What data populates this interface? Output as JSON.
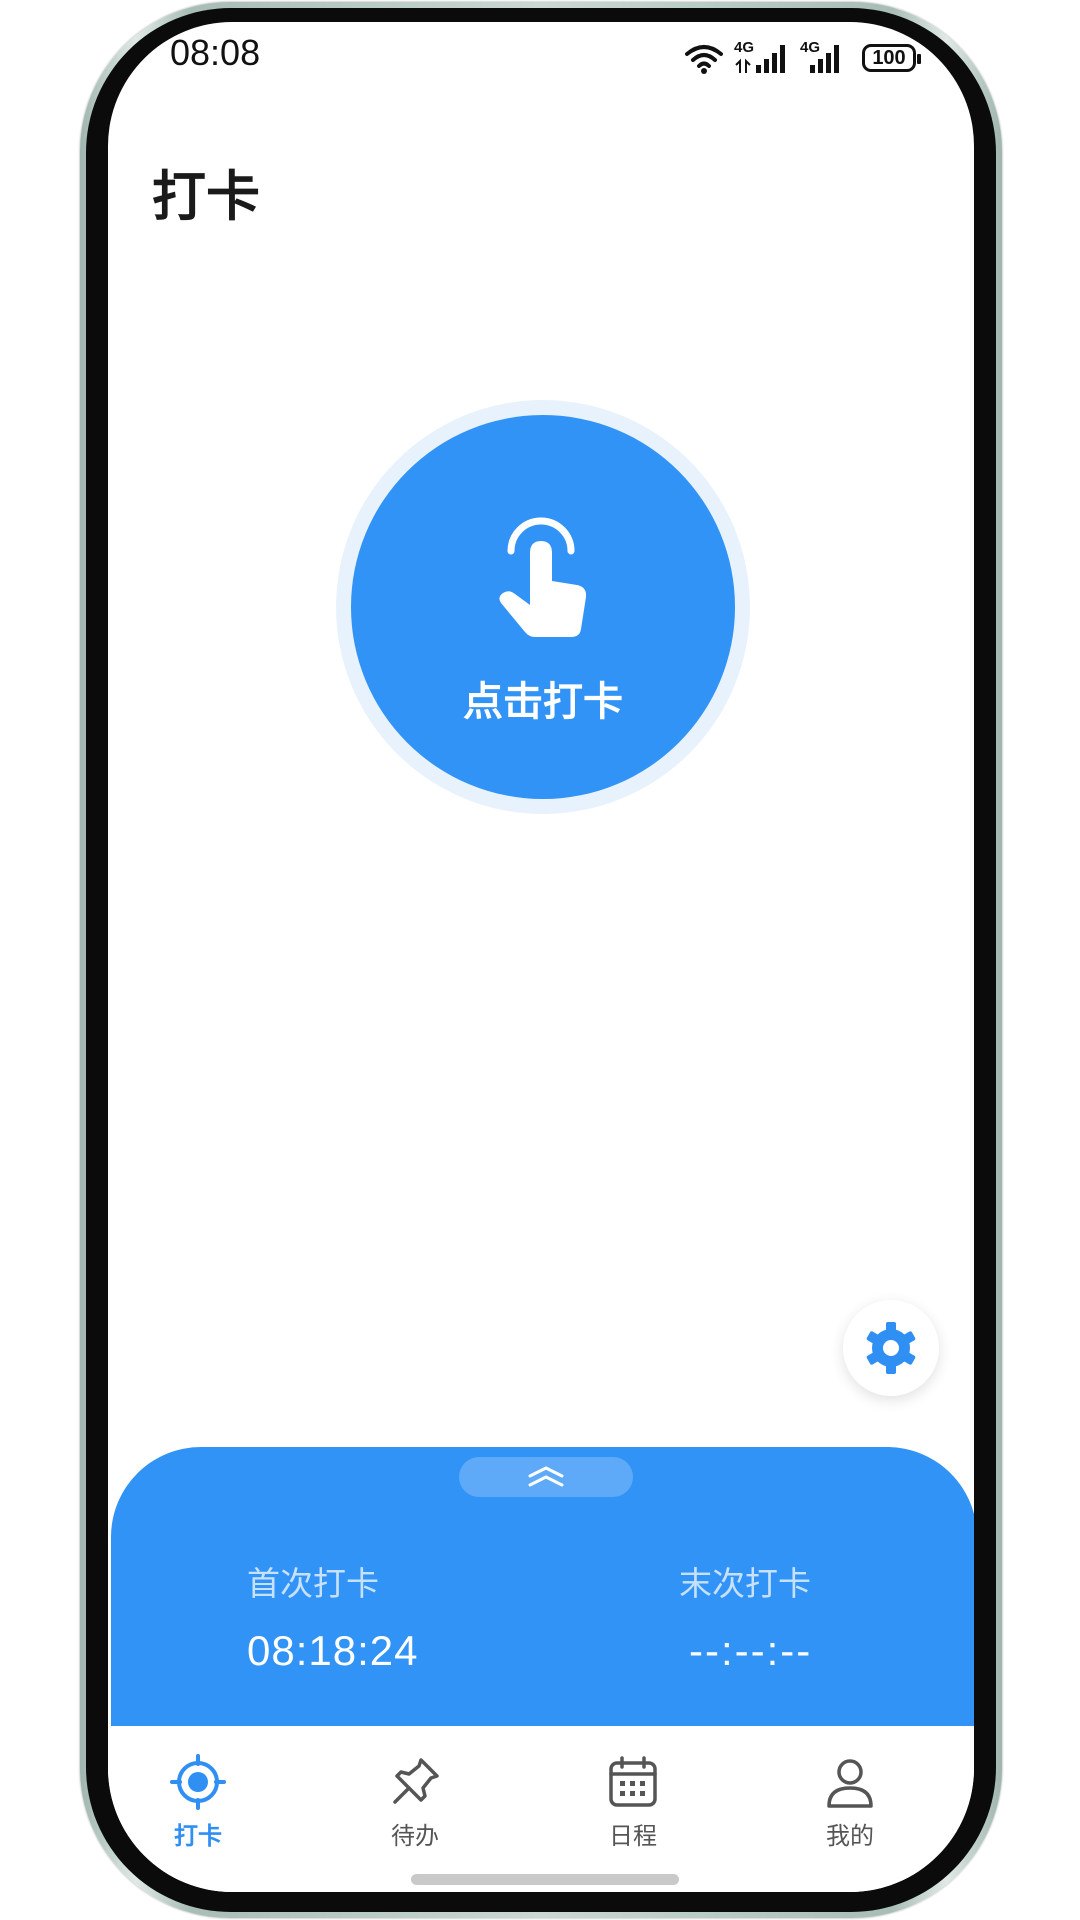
{
  "status_bar": {
    "time": "08:08",
    "battery": "100",
    "network_1": "4G",
    "network_2": "4G"
  },
  "page": {
    "title": "打卡"
  },
  "punch_button": {
    "label": "点击打卡",
    "icon": "tap-hand-icon"
  },
  "settings": {
    "icon": "gear-icon"
  },
  "summary": {
    "first_label": "首次打卡",
    "first_time": "08:18:24",
    "last_label": "末次打卡",
    "last_time": "--:--:--"
  },
  "tabs": [
    {
      "label": "打卡",
      "icon": "locate-icon",
      "active": true
    },
    {
      "label": "待办",
      "icon": "pin-icon",
      "active": false
    },
    {
      "label": "日程",
      "icon": "calendar-icon",
      "active": false
    },
    {
      "label": "我的",
      "icon": "person-icon",
      "active": false
    }
  ],
  "colors": {
    "accent": "#3293f6",
    "tab_active": "#2f8ff3",
    "title": "#1a1a1a"
  }
}
